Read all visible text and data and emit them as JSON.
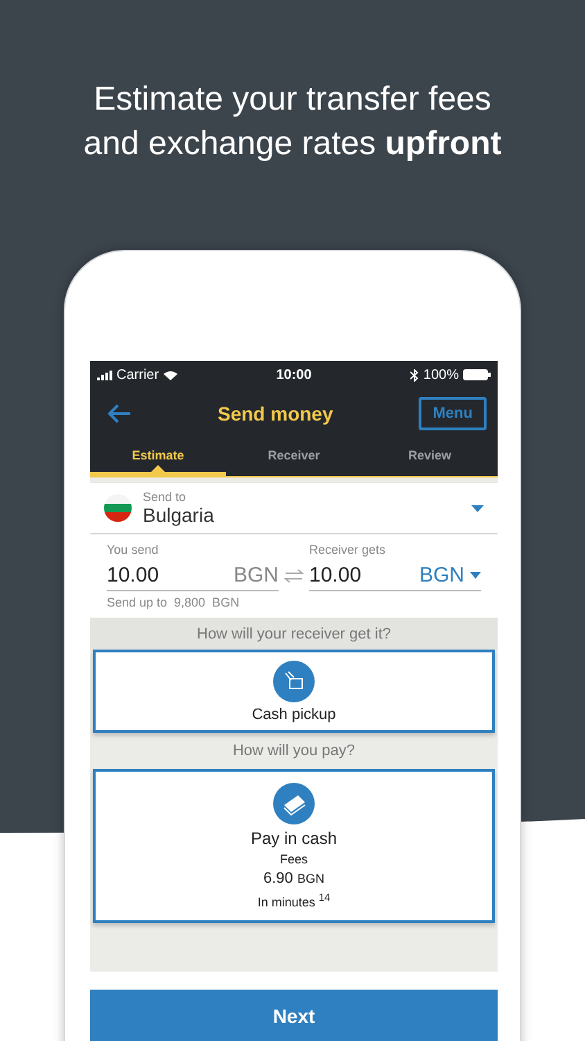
{
  "headline_lines": [
    "Estimate your transfer fees",
    "and exchange rates **upfront**"
  ],
  "status_bar": {
    "carrier": "Carrier",
    "time": "10:00",
    "battery": "100%"
  },
  "nav": {
    "title": "Send money",
    "menu_button": "Menu"
  },
  "tabs": [
    {
      "label": "Estimate",
      "selected": true
    },
    {
      "label": "Receiver",
      "selected": false
    },
    {
      "label": "Review",
      "selected": false
    }
  ],
  "destination": {
    "label": "Send to",
    "country": "Bulgaria"
  },
  "amounts": {
    "send": {
      "label": "You send",
      "value": "10.00",
      "currency": "BGN"
    },
    "receive": {
      "label": "Receiver gets",
      "value": "10.00",
      "currency": "BGN"
    },
    "limit": "Send up to  9,800  BGN"
  },
  "receive_question": "How will your receiver get it?",
  "receive_option": {
    "label": "Cash pickup",
    "selected": true
  },
  "pay_question": "How will you pay?",
  "pay_option": {
    "label": "Pay in cash",
    "selected": true,
    "fees_label": "Fees",
    "fee": "6.90",
    "fee_currency": "BGN",
    "speed": "In minutes $^{14}$"
  },
  "next_button": "Next"
}
